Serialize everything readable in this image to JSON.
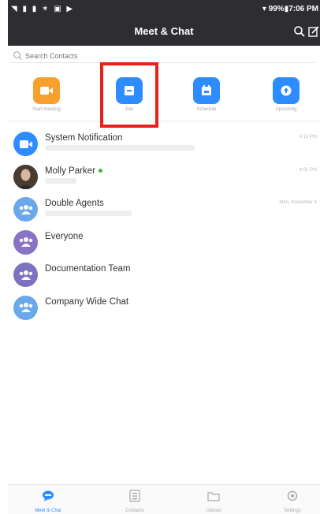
{
  "status_bar": {
    "left_icons": "◥ ▮ ▮ ✶ ▣ ▶",
    "right": "▾ 99%▮7:06 PM"
  },
  "header": {
    "title": "Meet & Chat"
  },
  "search": {
    "placeholder": "Search Contacts"
  },
  "actions": [
    {
      "label": "Start meeting",
      "color": "#f7a030"
    },
    {
      "label": "Join",
      "color": "#2d8cff"
    },
    {
      "label": "Schedule",
      "color": "#2d8cff"
    },
    {
      "label": "Upcoming",
      "color": "#2d8cff"
    }
  ],
  "chats": [
    {
      "name": "System Notification",
      "time": "4:18 PM",
      "avatar": "zoom-icon"
    },
    {
      "name": "Molly Parker",
      "time": "4:01 PM",
      "avatar": "photo"
    },
    {
      "name": "Double Agents",
      "time": "Mon, November 6",
      "avatar": "group-icon"
    },
    {
      "name": "Everyone",
      "time": "",
      "avatar": "group-icon"
    },
    {
      "name": "Documentation Team",
      "time": "",
      "avatar": "group-icon"
    },
    {
      "name": "Company Wide Chat",
      "time": "",
      "avatar": "group-icon"
    }
  ],
  "tabs": [
    {
      "label": "Meet & Chat",
      "active": true
    },
    {
      "label": "Contacts",
      "active": false
    },
    {
      "label": "Upload",
      "active": false
    },
    {
      "label": "Settings",
      "active": false
    }
  ],
  "colors": {
    "accent": "#2d8cff",
    "header_bg": "#2d2d32",
    "group_blue": "#6aa8ea",
    "group_purple": "#8a72c4",
    "highlight": "#e8221a"
  }
}
